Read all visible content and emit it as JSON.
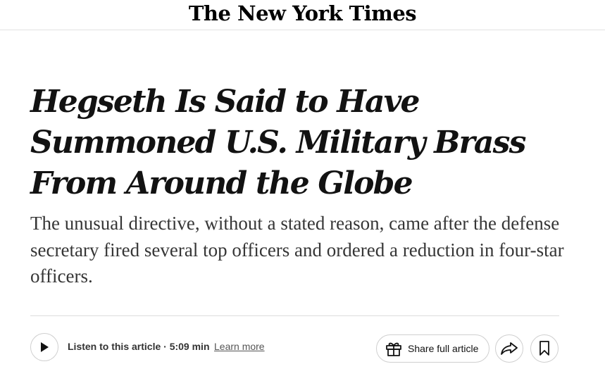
{
  "masthead": {
    "logo_text": "The New York Times"
  },
  "article": {
    "headline": "Hegseth Is Said to Have Summoned U.S. Military Brass From Around the Globe",
    "summary": "The unusual directive, without a stated reason, came after the defense secretary fired several top officers and ordered a reduction in four-star officers."
  },
  "audio": {
    "play_icon": "play-icon",
    "listen_label": "Listen to this article · 5:09 min",
    "learn_more": "Learn more"
  },
  "actions": {
    "share_label": "Share full article",
    "gift_icon": "gift-icon",
    "forward_icon": "forward-arrow-icon",
    "bookmark_icon": "bookmark-icon"
  }
}
